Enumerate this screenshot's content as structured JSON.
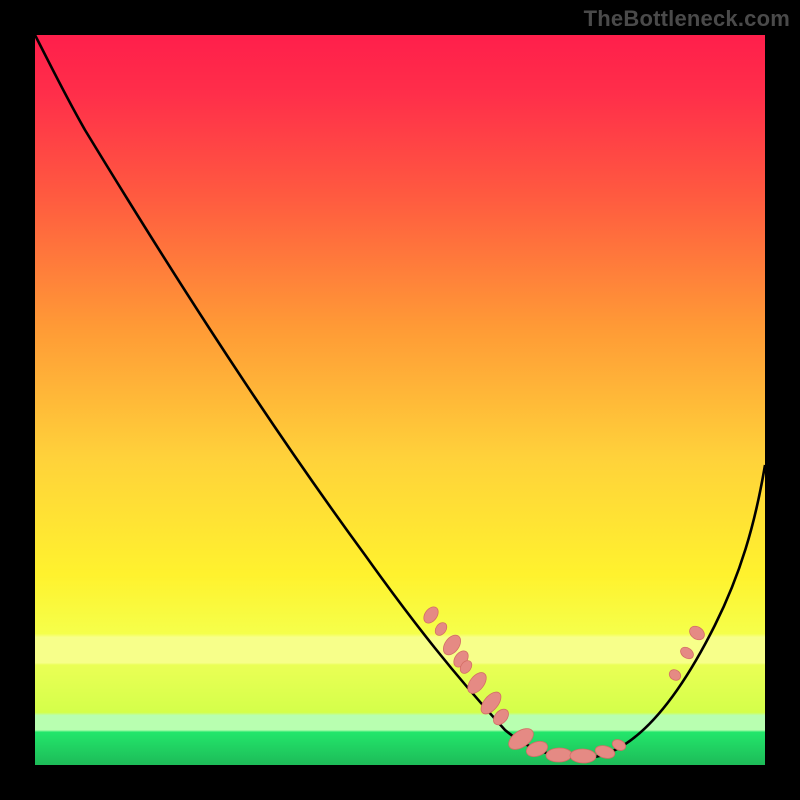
{
  "watermark": "TheBottleneck.com",
  "colors": {
    "black": "#000000",
    "curve": "#000000",
    "marker_fill": "#e58a84",
    "marker_stroke": "#d46e66",
    "grad_top": "#ff1f4b",
    "grad_mid1": "#ff6b3d",
    "grad_mid2": "#ffd23a",
    "grad_mid3": "#fff12e",
    "grad_band": "#f7ff6a",
    "grad_green": "#23e66b",
    "grad_green2": "#1dbb58"
  },
  "chart_data": {
    "type": "line",
    "title": "",
    "xlabel": "",
    "ylabel": "",
    "xlim": [
      0,
      100
    ],
    "ylim": [
      0,
      100
    ],
    "grid": false,
    "legend": false,
    "background": "vertical-gradient red→yellow→green (heatmap style)",
    "series": [
      {
        "name": "bottleneck-curve",
        "x": [
          0,
          4,
          10,
          18,
          28,
          38,
          48,
          55,
          60,
          65,
          70,
          75,
          80,
          85,
          88,
          92,
          96,
          100
        ],
        "y": [
          100,
          96,
          88,
          76,
          61,
          45,
          29,
          18,
          11,
          5,
          2,
          1.5,
          3,
          8,
          13,
          22,
          33,
          44
        ]
      }
    ],
    "markers": {
      "name": "highlighted-points",
      "style": "pill",
      "points": [
        {
          "x": 55,
          "y": 20
        },
        {
          "x": 56.5,
          "y": 18
        },
        {
          "x": 58,
          "y": 15
        },
        {
          "x": 59,
          "y": 13
        },
        {
          "x": 59.5,
          "y": 12
        },
        {
          "x": 61,
          "y": 9
        },
        {
          "x": 63,
          "y": 6
        },
        {
          "x": 64,
          "y": 5
        },
        {
          "x": 67,
          "y": 2.5
        },
        {
          "x": 69,
          "y": 2
        },
        {
          "x": 72,
          "y": 1.5
        },
        {
          "x": 75,
          "y": 1.5
        },
        {
          "x": 78,
          "y": 2.5
        },
        {
          "x": 80,
          "y": 3.5
        },
        {
          "x": 88,
          "y": 13
        },
        {
          "x": 89.5,
          "y": 16
        },
        {
          "x": 91,
          "y": 19
        }
      ]
    }
  }
}
